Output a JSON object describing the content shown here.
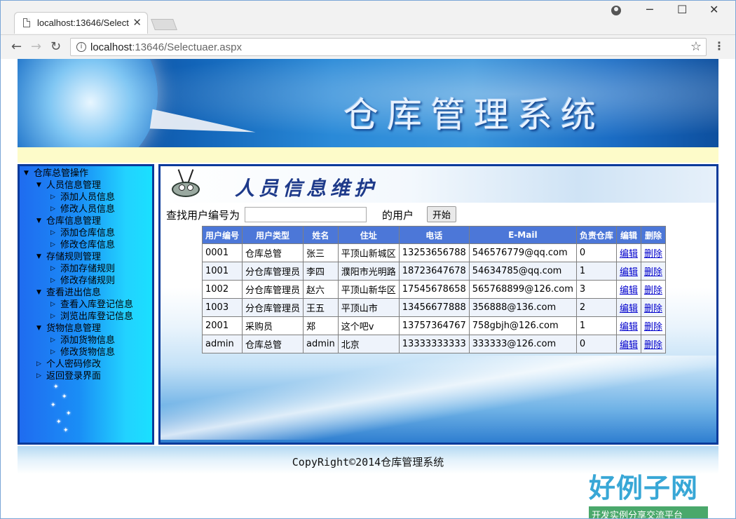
{
  "browser": {
    "tab_title": "localhost:13646/Select",
    "url_host": "localhost",
    "url_rest": ":13646/Selectuaer.aspx"
  },
  "banner": {
    "title": "仓库管理系统"
  },
  "sidebar": {
    "items": [
      {
        "label": "仓库总管操作",
        "level": 0,
        "expanded": true
      },
      {
        "label": "人员信息管理",
        "level": 1,
        "expanded": true
      },
      {
        "label": "添加人员信息",
        "level": 2
      },
      {
        "label": "修改人员信息",
        "level": 2
      },
      {
        "label": "仓库信息管理",
        "level": 1,
        "expanded": true
      },
      {
        "label": "添加仓库信息",
        "level": 2
      },
      {
        "label": "修改仓库信息",
        "level": 2
      },
      {
        "label": "存储规则管理",
        "level": 1,
        "expanded": true
      },
      {
        "label": "添加存储规则",
        "level": 2
      },
      {
        "label": "修改存储规则",
        "level": 2
      },
      {
        "label": "查看进出信息",
        "level": 1,
        "expanded": true
      },
      {
        "label": "查看入库登记信息",
        "level": 2
      },
      {
        "label": "浏览出库登记信息",
        "level": 2
      },
      {
        "label": "货物信息管理",
        "level": 1,
        "expanded": true
      },
      {
        "label": "添加货物信息",
        "level": 2
      },
      {
        "label": "修改货物信息",
        "level": 2
      },
      {
        "label": "个人密码修改",
        "level": 1,
        "expanded": false
      },
      {
        "label": "返回登录界面",
        "level": 1,
        "expanded": false
      }
    ]
  },
  "main": {
    "section_title": "人员信息维护",
    "search": {
      "label": "查找用户编号为",
      "value": "",
      "suffix": "的用户",
      "button": "开始"
    },
    "table": {
      "headers": [
        "用户编号",
        "用户类型",
        "姓名",
        "住址",
        "电话",
        "E-Mail",
        "负责仓库",
        "编辑",
        "删除"
      ],
      "rows": [
        [
          "0001",
          "仓库总管",
          "张三",
          "平顶山新城区",
          "13253656788",
          "546576779@qq.com",
          "0",
          "编辑",
          "删除"
        ],
        [
          "1001",
          "分仓库管理员",
          "李四",
          "濮阳市光明路",
          "18723647678",
          "54634785@qq.com",
          "1",
          "编辑",
          "删除"
        ],
        [
          "1002",
          "分仓库管理员",
          "赵六",
          "平顶山新华区",
          "17545678658",
          "565768899@126.com",
          "3",
          "编辑",
          "删除"
        ],
        [
          "1003",
          "分仓库管理员",
          "王五",
          "平顶山市",
          "13456677888",
          "356888@136.com",
          "2",
          "编辑",
          "删除"
        ],
        [
          "2001",
          "采购员",
          "郑",
          "这个吧v",
          "13757364767",
          "758gbjh@126.com",
          "1",
          "编辑",
          "删除"
        ],
        [
          "admin",
          "仓库总管",
          "admin",
          "北京",
          "13333333333",
          "333333@126.com",
          "0",
          "编辑",
          "删除"
        ]
      ]
    }
  },
  "footer": {
    "text": "CopyRight©2014仓库管理系统"
  },
  "watermark": {
    "title": "好例子网",
    "subtitle": "开发实例分享交流平台"
  }
}
